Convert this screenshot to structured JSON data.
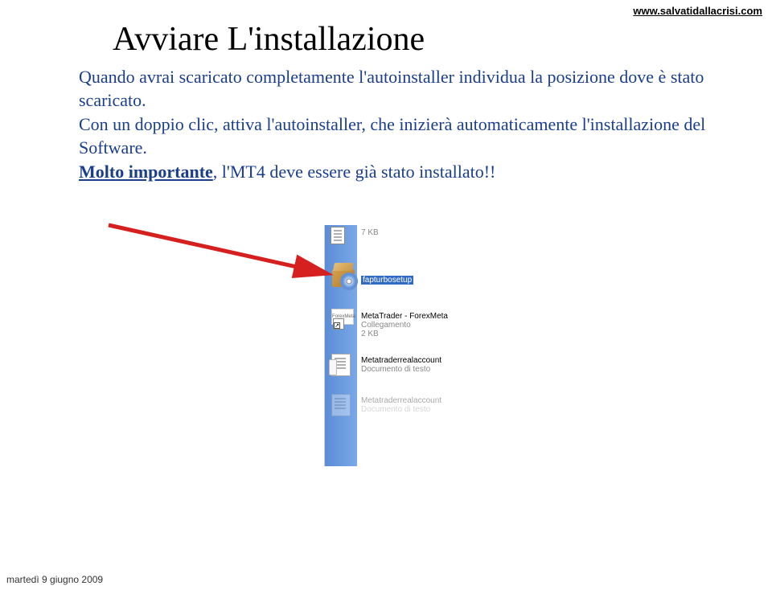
{
  "header": {
    "url": "www.salvatidallacrisi.com"
  },
  "title": "Avviare L'installazione",
  "body": {
    "p1": "Quando avrai scaricato completamente l'autoinstaller individua la posizione dove è stato scaricato.",
    "p2": "Con un doppio clic, attiva l'autoinstaller, che inizierà automaticamente l'installazione del Software.",
    "important_label": "Molto importante",
    "important_text": ", l'MT4 deve essere già stato installato!!"
  },
  "screenshot": {
    "row1_size": "7 KB",
    "row2_name": "fapturbosetup",
    "row3_title": "MetaTrader - ForexMeta",
    "row3_sub1": "Collegamento",
    "row3_sub2": "2 KB",
    "mt_logo_text": "ForexMeta",
    "row4_title": "Metatraderrealaccount",
    "row4_sub": "Documento di testo",
    "row5_title": "Metatraderrealaccount",
    "row5_sub": "Documento di testo"
  },
  "footer": {
    "date": "martedì 9 giugno 2009"
  }
}
